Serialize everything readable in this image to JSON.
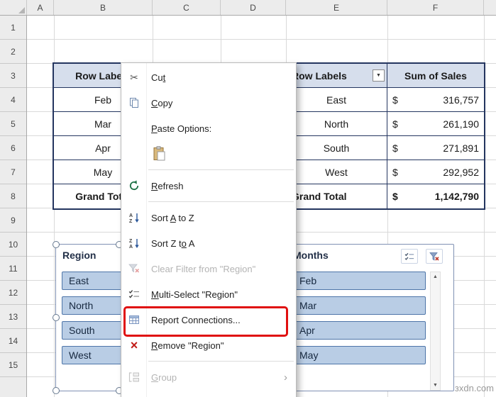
{
  "watermark": "зхdn.com",
  "sheet": {
    "columns": [
      "A",
      "B",
      "C",
      "D",
      "E",
      "F"
    ],
    "rows": [
      "1",
      "2",
      "3",
      "4",
      "5",
      "6",
      "7",
      "8",
      "9",
      "10",
      "11",
      "12",
      "13",
      "14",
      "15"
    ]
  },
  "left_pivot": {
    "header": "Row Labels",
    "items": [
      "Feb",
      "Mar",
      "Apr",
      "May"
    ],
    "footer": "Grand Total"
  },
  "right_pivot": {
    "row_header": "Row Labels",
    "value_header": "Sum of Sales",
    "filter_arrow": "▼",
    "rows": [
      {
        "label": "East",
        "currency": "$",
        "value": "316,757"
      },
      {
        "label": "North",
        "currency": "$",
        "value": "261,190"
      },
      {
        "label": "South",
        "currency": "$",
        "value": "271,891"
      },
      {
        "label": "West",
        "currency": "$",
        "value": "292,952"
      }
    ],
    "footer": {
      "label": "Grand Total",
      "currency": "$",
      "value": "1,142,790"
    }
  },
  "slicers": {
    "region": {
      "title": "Region",
      "items": [
        "East",
        "North",
        "South",
        "West"
      ]
    },
    "months": {
      "title": "Months",
      "items": [
        "Feb",
        "Mar",
        "Apr",
        "May"
      ],
      "scroll_up": "▲",
      "scroll_down": "▼"
    }
  },
  "context_menu": {
    "items": [
      {
        "label": "Cut",
        "accel_index": 2
      },
      {
        "label": "Copy",
        "accel_index": 0
      },
      {
        "label": "Paste Options:",
        "accel_index": 0
      },
      {
        "label": "Refresh",
        "accel_index": 0
      },
      {
        "label": "Sort A to Z",
        "accel_index": 5
      },
      {
        "label": "Sort Z to A",
        "accel_index": 8
      },
      {
        "label": "Clear Filter from \"Region\"",
        "accel_index": -1,
        "disabled": true
      },
      {
        "label": "Multi-Select \"Region\"",
        "accel_index": 0
      },
      {
        "label": "Report Connections...",
        "accel_index": -1,
        "highlighted": true
      },
      {
        "label": "Remove \"Region\"",
        "accel_index": 0
      },
      {
        "label": "Group",
        "accel_index": 0,
        "disabled": true,
        "has_submenu": true
      }
    ],
    "submenu_arrow": "›"
  },
  "colors": {
    "highlight_box": "#E01010",
    "pivot_header_bg": "#D6DEEC",
    "pivot_border": "#24355F",
    "slicer_item_bg": "#B9CDE5",
    "slicer_item_border": "#4E75A8"
  }
}
